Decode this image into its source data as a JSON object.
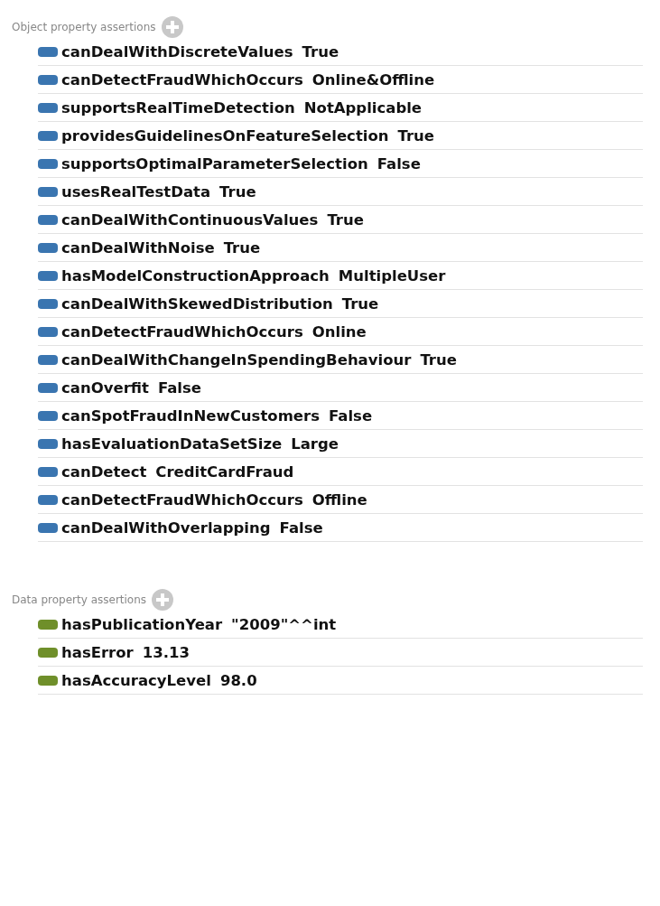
{
  "sections": [
    {
      "kind": "object",
      "title": "Object property assertions",
      "assertions": [
        {
          "property": "canDealWithDiscreteValues",
          "value": "True"
        },
        {
          "property": "canDetectFraudWhichOccurs",
          "value": "Online&Offline"
        },
        {
          "property": "supportsRealTimeDetection",
          "value": "NotApplicable"
        },
        {
          "property": "providesGuidelinesOnFeatureSelection",
          "value": "True"
        },
        {
          "property": "supportsOptimalParameterSelection",
          "value": "False"
        },
        {
          "property": "usesRealTestData",
          "value": "True"
        },
        {
          "property": "canDealWithContinuousValues",
          "value": "True"
        },
        {
          "property": "canDealWithNoise",
          "value": "True"
        },
        {
          "property": "hasModelConstructionApproach",
          "value": "MultipleUser"
        },
        {
          "property": "canDealWithSkewedDistribution",
          "value": "True"
        },
        {
          "property": "canDetectFraudWhichOccurs",
          "value": "Online"
        },
        {
          "property": "canDealWithChangeInSpendingBehaviour",
          "value": "True"
        },
        {
          "property": "canOverfit",
          "value": "False"
        },
        {
          "property": "canSpotFraudInNewCustomers",
          "value": "False"
        },
        {
          "property": "hasEvaluationDataSetSize",
          "value": "Large"
        },
        {
          "property": "canDetect",
          "value": "CreditCardFraud"
        },
        {
          "property": "canDetectFraudWhichOccurs",
          "value": "Offline"
        },
        {
          "property": "canDealWithOverlapping",
          "value": "False"
        }
      ]
    },
    {
      "kind": "data",
      "title": "Data property assertions",
      "assertions": [
        {
          "property": "hasPublicationYear",
          "value": "\"2009\"^^int"
        },
        {
          "property": "hasError",
          "value": "13.13"
        },
        {
          "property": "hasAccuracyLevel",
          "value": "98.0"
        }
      ]
    }
  ]
}
